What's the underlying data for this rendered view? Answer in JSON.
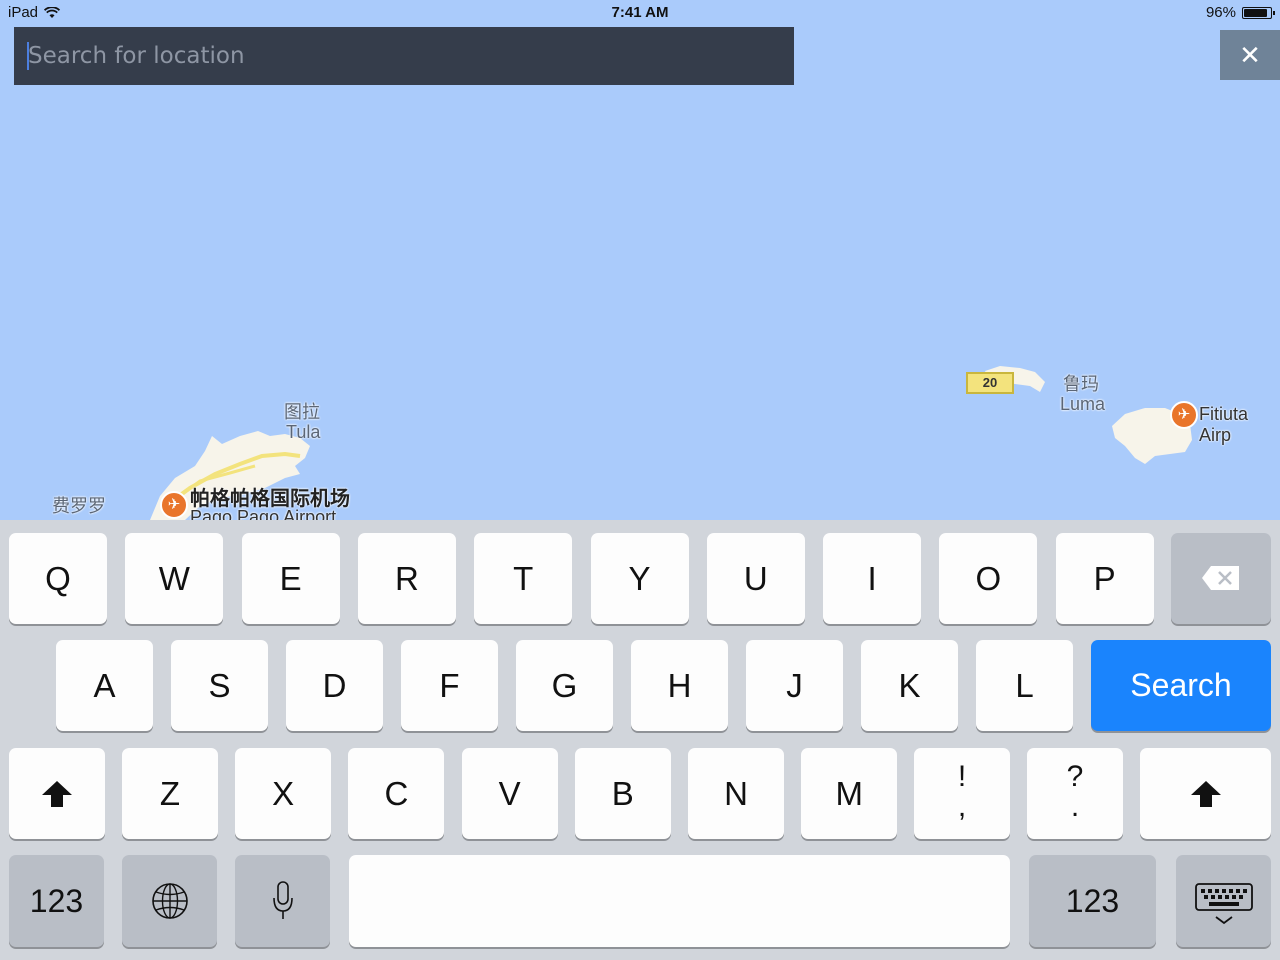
{
  "status_bar": {
    "device": "iPad",
    "time": "7:41 AM",
    "battery_percent": "96%",
    "battery_level": 0.96,
    "wifi_icon": "wifi-icon",
    "battery_icon": "battery-icon"
  },
  "search": {
    "placeholder": "Search for location",
    "value": "",
    "close_label": "✕"
  },
  "map": {
    "labels": {
      "tula_cn": "图拉",
      "tula_en": "Tula",
      "luma_cn": "鲁玛",
      "luma_en": "Luma",
      "feiluoluo_cn": "费罗罗",
      "pago_airport_cn": "帕格帕格国际机场",
      "pago_airport_en": "Pago Pago Airport",
      "fitiuta_airport": "Fitiuta Airp",
      "road_number": "20"
    },
    "colors": {
      "water": "#aacbfb",
      "land": "#f7f4ea",
      "road": "#f3e37d",
      "airport": "#e9752b"
    }
  },
  "keyboard": {
    "row1": [
      "Q",
      "W",
      "E",
      "R",
      "T",
      "Y",
      "U",
      "I",
      "O",
      "P"
    ],
    "row2": [
      "A",
      "S",
      "D",
      "F",
      "G",
      "H",
      "J",
      "K",
      "L"
    ],
    "row3": [
      "Z",
      "X",
      "C",
      "V",
      "B",
      "N",
      "M"
    ],
    "punct1": {
      "top": "!",
      "bottom": ","
    },
    "punct2": {
      "top": "?",
      "bottom": "."
    },
    "search_label": "Search",
    "numbers_label": "123",
    "backspace_icon": "backspace-icon",
    "shift_icon": "shift-icon",
    "globe_icon": "globe-icon",
    "mic_icon": "microphone-icon",
    "hide_keyboard_icon": "keyboard-hide-icon",
    "accent_color": "#1a84fd"
  }
}
